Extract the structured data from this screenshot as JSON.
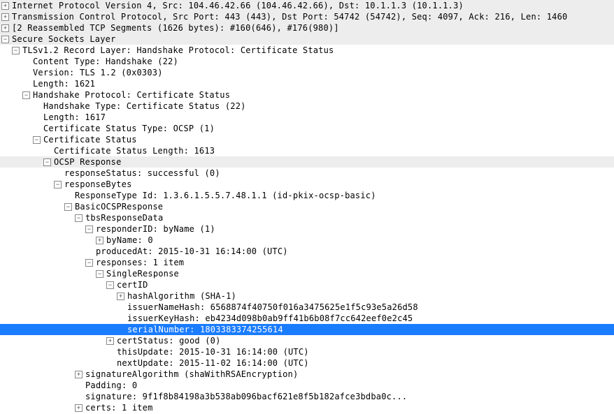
{
  "lines": [
    {
      "indent": 0,
      "toggle": "plus",
      "style": "header",
      "interact": true,
      "name": "row-ip",
      "text": "Internet Protocol Version 4, Src: 104.46.42.66 (104.46.42.66), Dst: 10.1.1.3 (10.1.1.3)"
    },
    {
      "indent": 0,
      "toggle": "plus",
      "style": "header",
      "interact": true,
      "name": "row-tcp",
      "text": "Transmission Control Protocol, Src Port: 443 (443), Dst Port: 54742 (54742), Seq: 4097, Ack: 216, Len: 1460"
    },
    {
      "indent": 0,
      "toggle": "plus",
      "style": "header",
      "interact": true,
      "name": "row-reassembled",
      "text": "[2 Reassembled TCP Segments (1626 bytes): #160(646), #176(980)]"
    },
    {
      "indent": 0,
      "toggle": "minus",
      "style": "highlight",
      "interact": true,
      "name": "row-ssl",
      "text": "Secure Sockets Layer"
    },
    {
      "indent": 1,
      "toggle": "minus",
      "style": "",
      "interact": true,
      "name": "row-record-layer",
      "text": "TLSv1.2 Record Layer: Handshake Protocol: Certificate Status"
    },
    {
      "indent": 2,
      "toggle": "none",
      "style": "",
      "interact": false,
      "name": "row-content-type",
      "text": "Content Type: Handshake (22)"
    },
    {
      "indent": 2,
      "toggle": "none",
      "style": "",
      "interact": false,
      "name": "row-version",
      "text": "Version: TLS 1.2 (0x0303)"
    },
    {
      "indent": 2,
      "toggle": "none",
      "style": "",
      "interact": false,
      "name": "row-length-1",
      "text": "Length: 1621"
    },
    {
      "indent": 2,
      "toggle": "minus",
      "style": "",
      "interact": true,
      "name": "row-handshake",
      "text": "Handshake Protocol: Certificate Status"
    },
    {
      "indent": 3,
      "toggle": "none",
      "style": "",
      "interact": false,
      "name": "row-hs-type",
      "text": "Handshake Type: Certificate Status (22)"
    },
    {
      "indent": 3,
      "toggle": "none",
      "style": "",
      "interact": false,
      "name": "row-length-2",
      "text": "Length: 1617"
    },
    {
      "indent": 3,
      "toggle": "none",
      "style": "",
      "interact": false,
      "name": "row-cert-stat-type",
      "text": "Certificate Status Type: OCSP (1)"
    },
    {
      "indent": 3,
      "toggle": "minus",
      "style": "",
      "interact": true,
      "name": "row-cert-status",
      "text": "Certificate Status"
    },
    {
      "indent": 4,
      "toggle": "none",
      "style": "",
      "interact": false,
      "name": "row-cert-stat-len",
      "text": "Certificate Status Length: 1613"
    },
    {
      "indent": 4,
      "toggle": "minus",
      "style": "highlight",
      "interact": true,
      "name": "row-ocsp",
      "text": "OCSP Response"
    },
    {
      "indent": 5,
      "toggle": "none",
      "style": "",
      "interact": false,
      "name": "row-resp-status",
      "text": "responseStatus: successful (0)"
    },
    {
      "indent": 5,
      "toggle": "minus",
      "style": "",
      "interact": true,
      "name": "row-resp-bytes",
      "text": "responseBytes"
    },
    {
      "indent": 6,
      "toggle": "none",
      "style": "",
      "interact": false,
      "name": "row-resp-type-id",
      "text": "ResponseType Id: 1.3.6.1.5.5.7.48.1.1 (id-pkix-ocsp-basic)"
    },
    {
      "indent": 6,
      "toggle": "minus",
      "style": "",
      "interact": true,
      "name": "row-basic-ocsp",
      "text": "BasicOCSPResponse"
    },
    {
      "indent": 7,
      "toggle": "minus",
      "style": "",
      "interact": true,
      "name": "row-tbs",
      "text": "tbsResponseData"
    },
    {
      "indent": 8,
      "toggle": "minus",
      "style": "",
      "interact": true,
      "name": "row-responder-id",
      "text": "responderID: byName (1)"
    },
    {
      "indent": 9,
      "toggle": "plus",
      "style": "",
      "interact": true,
      "name": "row-byname",
      "text": "byName: 0"
    },
    {
      "indent": 8,
      "toggle": "none",
      "style": "",
      "interact": false,
      "name": "row-produced-at",
      "text": "producedAt: 2015-10-31 16:14:00 (UTC)"
    },
    {
      "indent": 8,
      "toggle": "minus",
      "style": "",
      "interact": true,
      "name": "row-responses",
      "text": "responses: 1 item"
    },
    {
      "indent": 9,
      "toggle": "minus",
      "style": "",
      "interact": true,
      "name": "row-single-resp",
      "text": "SingleResponse"
    },
    {
      "indent": 10,
      "toggle": "minus",
      "style": "",
      "interact": true,
      "name": "row-certid",
      "text": "certID"
    },
    {
      "indent": 11,
      "toggle": "plus",
      "style": "",
      "interact": true,
      "name": "row-hash-alg",
      "text": "hashAlgorithm (SHA-1)"
    },
    {
      "indent": 11,
      "toggle": "none",
      "style": "",
      "interact": false,
      "name": "row-issuer-name",
      "text": "issuerNameHash: 6568874f40750f016a3475625e1f5c93e5a26d58"
    },
    {
      "indent": 11,
      "toggle": "none",
      "style": "",
      "interact": false,
      "name": "row-issuer-key",
      "text": "issuerKeyHash: eb4234d098b0ab9ff41b6b08f7cc642eef0e2c45"
    },
    {
      "indent": 11,
      "toggle": "none",
      "style": "selected",
      "interact": true,
      "name": "row-serial-number",
      "text": "serialNumber: 1803383374255614"
    },
    {
      "indent": 10,
      "toggle": "plus",
      "style": "",
      "interact": true,
      "name": "row-cert-status-g",
      "text": "certStatus: good (0)"
    },
    {
      "indent": 10,
      "toggle": "none",
      "style": "",
      "interact": false,
      "name": "row-this-update",
      "text": "thisUpdate: 2015-10-31 16:14:00 (UTC)"
    },
    {
      "indent": 10,
      "toggle": "none",
      "style": "",
      "interact": false,
      "name": "row-next-update",
      "text": "nextUpdate: 2015-11-02 16:14:00 (UTC)"
    },
    {
      "indent": 7,
      "toggle": "plus",
      "style": "",
      "interact": true,
      "name": "row-sig-alg",
      "text": "signatureAlgorithm (shaWithRSAEncryption)"
    },
    {
      "indent": 7,
      "toggle": "none",
      "style": "",
      "interact": false,
      "name": "row-padding",
      "text": "Padding: 0"
    },
    {
      "indent": 7,
      "toggle": "none",
      "style": "",
      "interact": false,
      "name": "row-signature",
      "text": "signature: 9f1f8b84198a3b538ab096bacf621e8f5b182afce3bdba0c..."
    },
    {
      "indent": 7,
      "toggle": "plus",
      "style": "",
      "interact": true,
      "name": "row-certs",
      "text": "certs: 1 item"
    }
  ]
}
